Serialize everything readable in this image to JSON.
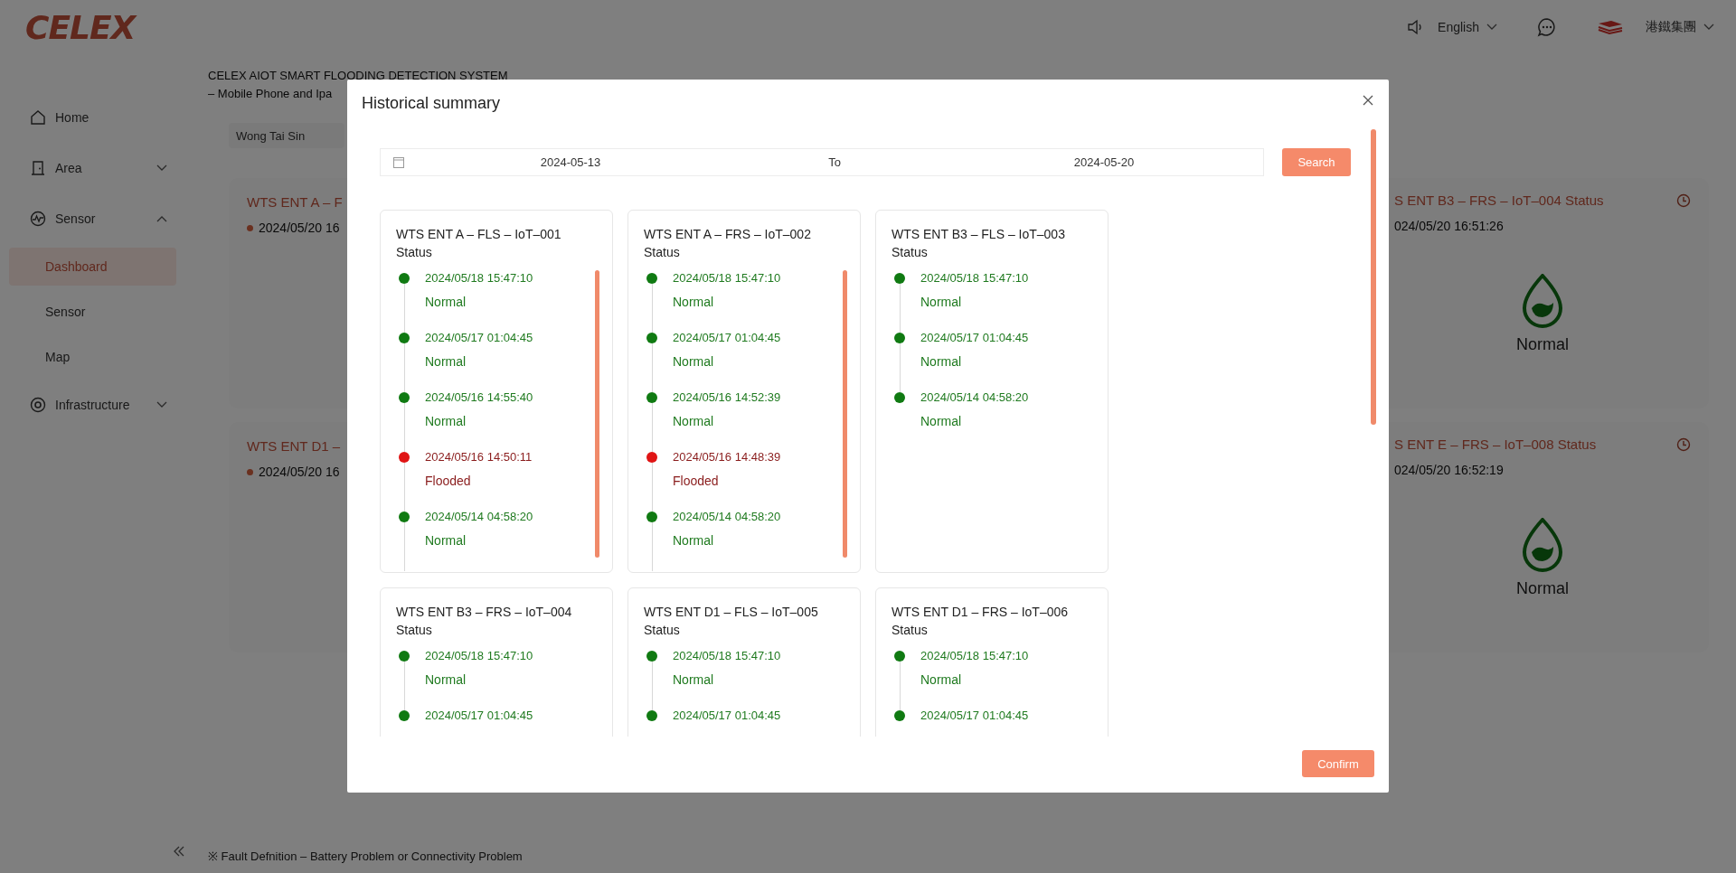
{
  "header": {
    "logo": "CELEX",
    "language": "English",
    "organization": "港鐵集團"
  },
  "sidebar": {
    "items": [
      {
        "label": "Home",
        "kind": "link"
      },
      {
        "label": "Area",
        "kind": "group",
        "expanded": false
      },
      {
        "label": "Sensor",
        "kind": "group",
        "expanded": true,
        "children": [
          {
            "label": "Dashboard",
            "selected": true
          },
          {
            "label": "Sensor",
            "selected": false
          },
          {
            "label": "Map",
            "selected": false
          }
        ]
      },
      {
        "label": "Infrastructure",
        "kind": "group",
        "expanded": false
      }
    ]
  },
  "page": {
    "title": "CELEX AIOT SMART FLOODING DETECTION SYSTEM",
    "subtitle": "– Mobile Phone and Ipa",
    "area_filter": "Wong Tai Sin",
    "left_cards": [
      {
        "title": "WTS ENT A – F",
        "time": "2024/05/20 16"
      },
      {
        "title": "WTS ENT D1 –",
        "time": "2024/05/20 16"
      }
    ],
    "right_cards": [
      {
        "title": "S ENT B3 – FRS – IoT–004 Status",
        "time": "024/05/20 16:51:26",
        "status": "Normal"
      },
      {
        "title": "S ENT E – FRS – IoT–008 Status",
        "time": "024/05/20 16:52:19",
        "status": "Normal"
      }
    ],
    "footer_note": "※ Fault Defnition – Battery Problem or Connectivity Problem"
  },
  "modal": {
    "title": "Historical summary",
    "date_from": "2024-05-13",
    "date_separator": "To",
    "date_to": "2024-05-20",
    "search_button": "Search",
    "confirm_button": "Confirm",
    "sensors": [
      {
        "title": "WTS ENT A – FLS – IoT–001 Status",
        "events": [
          {
            "time": "2024/05/18 15:47:10",
            "status": "Normal",
            "kind": "normal"
          },
          {
            "time": "2024/05/17 01:04:45",
            "status": "Normal",
            "kind": "normal"
          },
          {
            "time": "2024/05/16 14:55:40",
            "status": "Normal",
            "kind": "normal"
          },
          {
            "time": "2024/05/16 14:50:11",
            "status": "Flooded",
            "kind": "flooded"
          },
          {
            "time": "2024/05/14 04:58:20",
            "status": "Normal",
            "kind": "normal"
          }
        ]
      },
      {
        "title": "WTS ENT A – FRS – IoT–002 Status",
        "events": [
          {
            "time": "2024/05/18 15:47:10",
            "status": "Normal",
            "kind": "normal"
          },
          {
            "time": "2024/05/17 01:04:45",
            "status": "Normal",
            "kind": "normal"
          },
          {
            "time": "2024/05/16 14:52:39",
            "status": "Normal",
            "kind": "normal"
          },
          {
            "time": "2024/05/16 14:48:39",
            "status": "Flooded",
            "kind": "flooded"
          },
          {
            "time": "2024/05/14 04:58:20",
            "status": "Normal",
            "kind": "normal"
          }
        ]
      },
      {
        "title": "WTS ENT B3 – FLS – IoT–003 Status",
        "events": [
          {
            "time": "2024/05/18 15:47:10",
            "status": "Normal",
            "kind": "normal"
          },
          {
            "time": "2024/05/17 01:04:45",
            "status": "Normal",
            "kind": "normal"
          },
          {
            "time": "2024/05/14 04:58:20",
            "status": "Normal",
            "kind": "normal"
          }
        ]
      },
      {
        "title": "WTS ENT B3 – FRS – IoT–004 Status",
        "events": [
          {
            "time": "2024/05/18 15:47:10",
            "status": "Normal",
            "kind": "normal"
          },
          {
            "time": "2024/05/17 01:04:45",
            "kind": "normal"
          }
        ]
      },
      {
        "title": "WTS ENT D1 – FLS – IoT–005 Status",
        "events": [
          {
            "time": "2024/05/18 15:47:10",
            "status": "Normal",
            "kind": "normal"
          },
          {
            "time": "2024/05/17 01:04:45",
            "kind": "normal"
          }
        ]
      },
      {
        "title": "WTS ENT D1 – FRS – IoT–006 Status",
        "events": [
          {
            "time": "2024/05/18 15:47:10",
            "status": "Normal",
            "kind": "normal"
          },
          {
            "time": "2024/05/17 01:04:45",
            "kind": "normal"
          }
        ]
      }
    ]
  }
}
